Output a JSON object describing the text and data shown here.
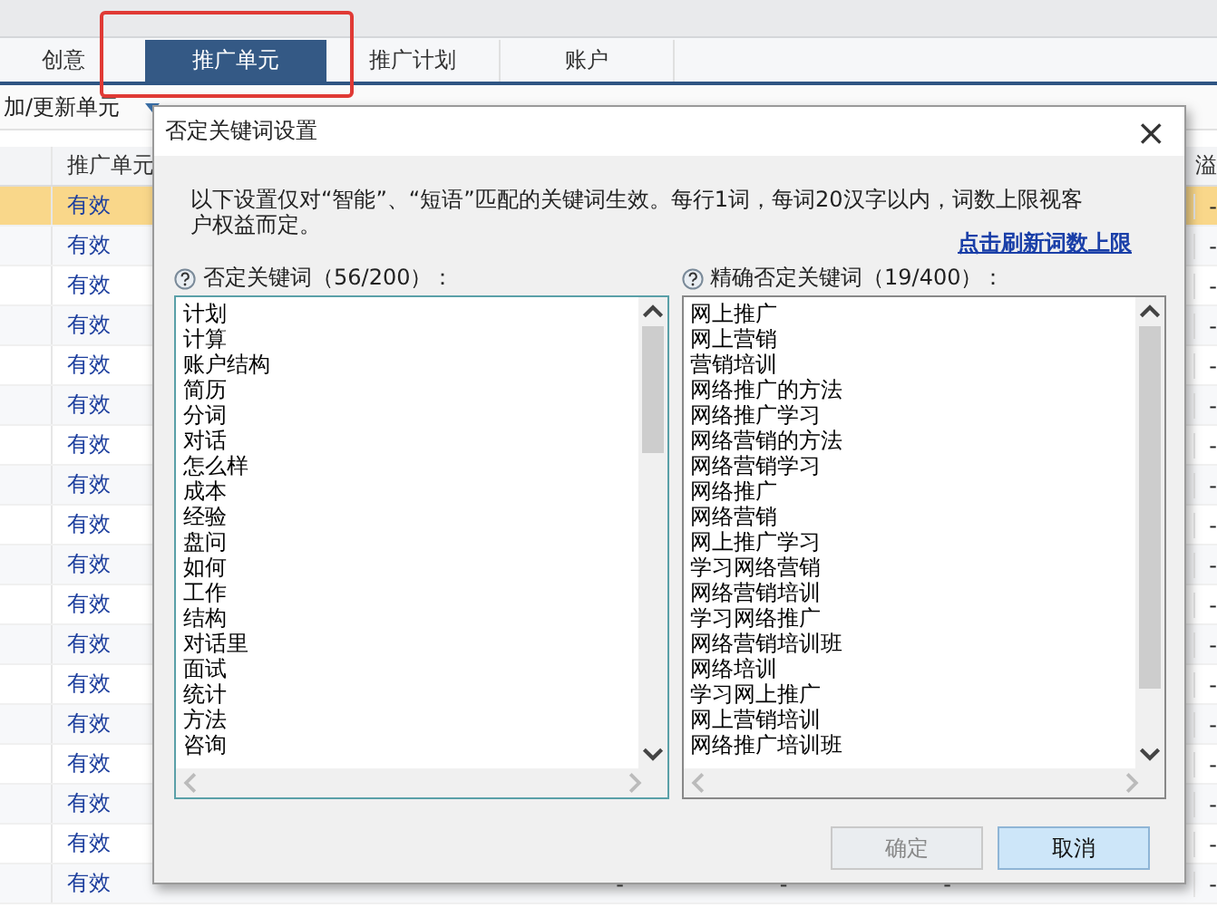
{
  "tabs": [
    {
      "label": "创意",
      "selected": false
    },
    {
      "label": "推广单元",
      "selected": true
    },
    {
      "label": "推广计划",
      "selected": false
    },
    {
      "label": "账户",
      "selected": false
    }
  ],
  "toolbar": {
    "add_button": "加/更新单元"
  },
  "table": {
    "columns": [
      {
        "label": "推广单元"
      },
      {
        "label": "溢"
      }
    ],
    "rows": [
      {
        "selected": true,
        "status": "有效",
        "tail": "-"
      },
      {
        "selected": false,
        "status": "有效",
        "tail": "-"
      },
      {
        "selected": false,
        "status": "有效",
        "tail": "-"
      },
      {
        "selected": false,
        "status": "有效",
        "tail": "-"
      },
      {
        "selected": false,
        "status": "有效",
        "tail": "-"
      },
      {
        "selected": false,
        "status": "有效",
        "tail": "-"
      },
      {
        "selected": false,
        "status": "有效",
        "tail": "-"
      },
      {
        "selected": false,
        "status": "有效",
        "tail": "-"
      },
      {
        "selected": false,
        "status": "有效",
        "tail": "-"
      },
      {
        "selected": false,
        "status": "有效",
        "tail": "-"
      },
      {
        "selected": false,
        "status": "有效",
        "tail": "-"
      },
      {
        "selected": false,
        "status": "有效",
        "tail": "-"
      },
      {
        "selected": false,
        "status": "有效",
        "tail": "-"
      },
      {
        "selected": false,
        "status": "有效",
        "tail": "-"
      },
      {
        "selected": false,
        "status": "有效",
        "tail": "-"
      },
      {
        "selected": false,
        "status": "有效",
        "tail": "-"
      },
      {
        "selected": false,
        "status": "有效",
        "tail": "-"
      },
      {
        "selected": false,
        "status": "有效",
        "extra": [
          "-",
          "-",
          "-"
        ],
        "tail": "-"
      }
    ]
  },
  "dialog": {
    "title": "否定关键词设置",
    "close": "×",
    "description": "以下设置仅对“智能”、“短语”匹配的关键词生效。每行1词，每词20汉字以内，词数上限视客户权益而定。",
    "refresh_link": "点击刷新词数上限",
    "lists": [
      {
        "label": "否定关键词（56/200）：",
        "words": [
          "计划",
          "计算",
          "账户结构",
          "简历",
          "分词",
          "对话",
          "怎么样",
          "成本",
          "经验",
          "盘问",
          "如何",
          "工作",
          "结构",
          "对话里",
          "面试",
          "统计",
          "方法",
          "咨询"
        ]
      },
      {
        "label": "精确否定关键词（19/400）：",
        "words": [
          "网上推广",
          "网上营销",
          "营销培训",
          "网络推广的方法",
          "网络推广学习",
          "网络营销的方法",
          "网络营销学习",
          "网络推广",
          "网络营销",
          "网上推广学习",
          "学习网络营销",
          "网络营销培训",
          "学习网络推广",
          "网络营销培训班",
          "网络培训",
          "学习网上推广",
          "网上营销培训",
          "网络推广培训班"
        ]
      }
    ],
    "buttons": [
      {
        "label": "确定",
        "disabled": true
      },
      {
        "label": "取消",
        "disabled": false
      }
    ]
  }
}
